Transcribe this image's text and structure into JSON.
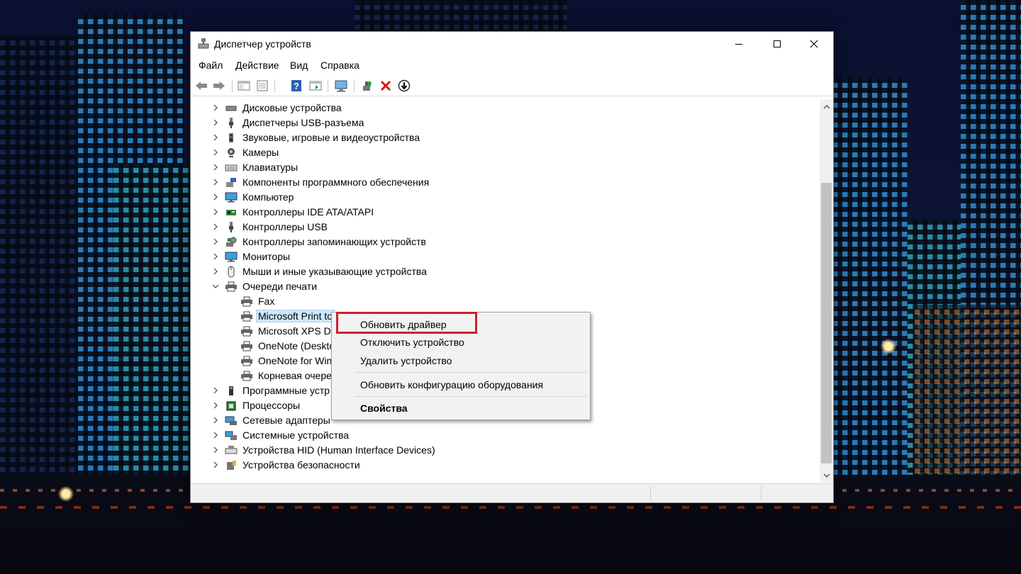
{
  "window": {
    "title": "Диспетчер устройств",
    "icon": "device-manager-icon"
  },
  "menu": [
    "Файл",
    "Действие",
    "Вид",
    "Справка"
  ],
  "toolbar": [
    "back-icon",
    "forward-icon",
    "show-hide-console-tree-icon",
    "properties-icon",
    "help-icon",
    "action-pane-icon",
    "scan-hardware-icon",
    "update-driver-icon",
    "uninstall-device-icon",
    "disable-device-icon"
  ],
  "tree": {
    "items": [
      {
        "label": "Дисковые устройства",
        "icon": "disk-drive-icon"
      },
      {
        "label": "Диспетчеры USB-разъема",
        "icon": "usb-connector-icon"
      },
      {
        "label": "Звуковые, игровые и видеоустройства",
        "icon": "speaker-icon"
      },
      {
        "label": "Камеры",
        "icon": "camera-icon"
      },
      {
        "label": "Клавиатуры",
        "icon": "keyboard-icon"
      },
      {
        "label": "Компоненты программного обеспечения",
        "icon": "software-component-icon"
      },
      {
        "label": "Компьютер",
        "icon": "computer-icon"
      },
      {
        "label": "Контроллеры IDE ATA/ATAPI",
        "icon": "ide-controller-icon"
      },
      {
        "label": "Контроллеры USB",
        "icon": "usb-icon"
      },
      {
        "label": "Контроллеры запоминающих устройств",
        "icon": "storage-controller-icon"
      },
      {
        "label": "Мониторы",
        "icon": "monitor-icon"
      },
      {
        "label": "Мыши и иные указывающие устройства",
        "icon": "mouse-icon"
      },
      {
        "label": "Очереди печати",
        "icon": "printer-icon",
        "expanded": true
      },
      {
        "label": "Fax",
        "icon": "printer-icon",
        "child": true
      },
      {
        "label": "Microsoft Print to",
        "icon": "printer-icon",
        "child": true,
        "selected": true
      },
      {
        "label": "Microsoft XPS Do",
        "icon": "printer-icon",
        "child": true
      },
      {
        "label": "OneNote (Deskto",
        "icon": "printer-icon",
        "child": true
      },
      {
        "label": "OneNote for Win",
        "icon": "printer-icon",
        "child": true
      },
      {
        "label": "Корневая очере",
        "icon": "printer-icon",
        "child": true
      },
      {
        "label": "Программные устр",
        "icon": "software-device-icon"
      },
      {
        "label": "Процессоры",
        "icon": "processor-icon"
      },
      {
        "label": "Сетевые адаптеры",
        "icon": "network-adapter-icon"
      },
      {
        "label": "Системные устройства",
        "icon": "system-device-icon"
      },
      {
        "label": "Устройства HID (Human Interface Devices)",
        "icon": "hid-icon"
      },
      {
        "label": "Устройства безопасности",
        "icon": "security-device-icon"
      }
    ]
  },
  "context_menu": {
    "items": [
      {
        "label": "Обновить драйвер",
        "highlighted": true
      },
      {
        "label": "Отключить устройство"
      },
      {
        "label": "Удалить устройство"
      },
      {
        "label": "Обновить конфигурацию оборудования"
      },
      {
        "label": "Свойства",
        "bold": true
      }
    ]
  },
  "colors": {
    "highlight_border": "#d0202a",
    "selection": "#cce8ff"
  }
}
